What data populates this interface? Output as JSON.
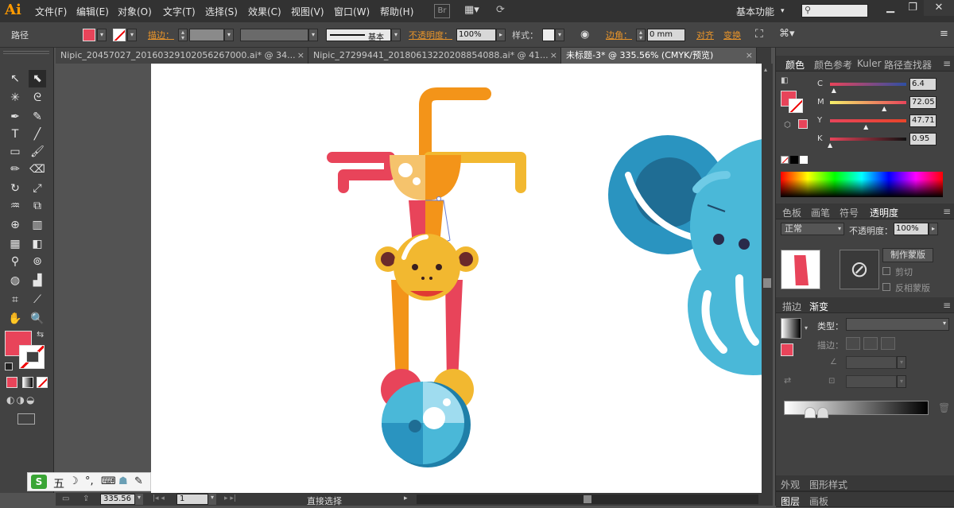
{
  "app": {
    "logo": "Ai"
  },
  "menu": [
    "文件(F)",
    "编辑(E)",
    "对象(O)",
    "文字(T)",
    "选择(S)",
    "效果(C)",
    "视图(V)",
    "窗口(W)",
    "帮助(H)"
  ],
  "menubar_right": {
    "br_label": "Br",
    "workspace": "基本功能",
    "search_placeholder": ""
  },
  "control_bar": {
    "selection_label": "路径",
    "stroke_label": "描边：",
    "stroke_profile": "基本",
    "opacity_label": "不透明度：",
    "opacity_value": "100%",
    "style_label": "样式：",
    "corner_label": "边角：",
    "corner_value": "0 mm",
    "align_label": "对齐",
    "transform_label": "变换"
  },
  "doc_tabs": [
    {
      "label": "Nipic_20457027_20160329102056267000.ai* @ 34...",
      "active": false
    },
    {
      "label": "Nipic_27299441_20180613220208854088.ai* @ 41...",
      "active": false
    },
    {
      "label": "未标题-3* @ 335.56% (CMYK/预览)",
      "active": true
    }
  ],
  "status_bar": {
    "zoom": "335.56",
    "page": "1",
    "tool_name": "直接选择"
  },
  "ime_bar": {
    "mode": "五"
  },
  "color_panel": {
    "tabs": [
      "颜色",
      "颜色参考",
      "Kuler",
      "路径查找器"
    ],
    "channels": [
      {
        "name": "C",
        "value": "6.4",
        "pos": 0.06
      },
      {
        "name": "M",
        "value": "72.05",
        "pos": 0.72
      },
      {
        "name": "Y",
        "value": "47.71",
        "pos": 0.48
      },
      {
        "name": "K",
        "value": "0.95",
        "pos": 0.01
      }
    ]
  },
  "transparency_panel": {
    "tabs": [
      "色板",
      "画笔",
      "符号",
      "透明度"
    ],
    "blend_mode": "正常",
    "opacity_label": "不透明度：",
    "opacity_value": "100%",
    "make_mask": "制作蒙版",
    "clip": "剪切",
    "invert_mask": "反相蒙版"
  },
  "gradient_panel": {
    "tabs": [
      "描边",
      "渐变"
    ],
    "type_label": "类型：",
    "stroke_label": "描边："
  },
  "bottom_panels": {
    "appearance_tabs": [
      "外观",
      "图形样式"
    ],
    "layer_tabs": [
      "图层",
      "画板"
    ]
  },
  "colors": {
    "fill": "#e8445a",
    "accent": "#e8942a",
    "monkey_orange": "#f39419",
    "monkey_yellow": "#f2b830",
    "monkey_red": "#e8445a",
    "elephant_blue": "#4ab8d8",
    "elephant_dark": "#1f7fa8"
  }
}
